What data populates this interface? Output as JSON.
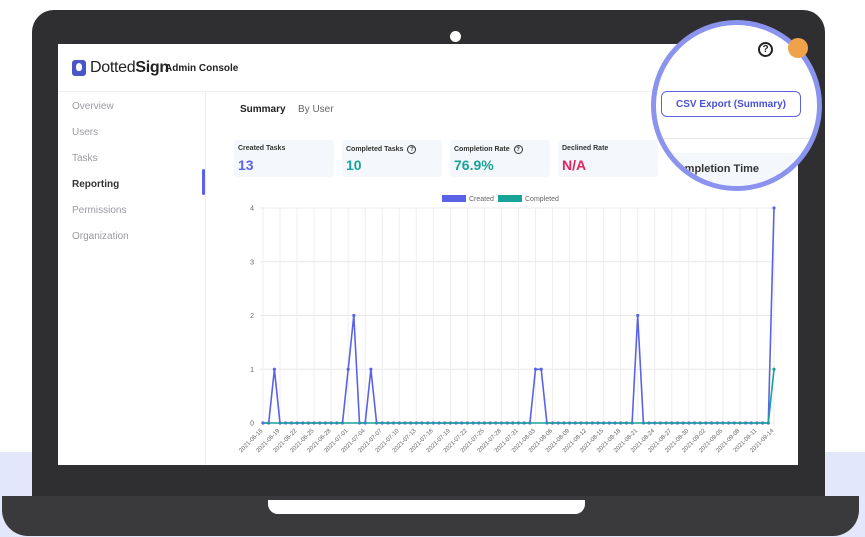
{
  "app": {
    "logo_light": "Dotted",
    "logo_bold": "Sign",
    "console_title": "Admin Console"
  },
  "sidebar": {
    "items": [
      {
        "label": "Overview"
      },
      {
        "label": "Users"
      },
      {
        "label": "Tasks"
      },
      {
        "label": "Reporting",
        "active": true
      },
      {
        "label": "Permissions"
      },
      {
        "label": "Organization"
      }
    ]
  },
  "tabs": [
    {
      "label": "Summary",
      "active": true
    },
    {
      "label": "By User"
    }
  ],
  "cards": [
    {
      "label": "Created Tasks",
      "value": "13",
      "color": "#5a63e6",
      "help": false
    },
    {
      "label": "Completed Tasks",
      "value": "10",
      "color": "#18a398",
      "help": true
    },
    {
      "label": "Completion Rate",
      "value": "76.9%",
      "color": "#18a398",
      "help": true
    },
    {
      "label": "Declined Rate",
      "value": "N/A",
      "color": "#e0245e",
      "help": false
    }
  ],
  "export": {
    "button_label": "CSV Export (Summary)",
    "completion_time_label": "Completion Time"
  },
  "colors": {
    "accent": "#5a63e6",
    "created": "#5a63e6",
    "completed": "#18a398",
    "declined": "#e0245e"
  },
  "icons": {
    "help": "question-circle-icon",
    "avatar": "user-avatar"
  },
  "chart_data": {
    "type": "line",
    "legend": [
      "Created",
      "Completed"
    ],
    "legend_position": "top-center",
    "ylim": [
      0,
      4
    ],
    "yticks": [
      "0",
      "1",
      "2",
      "3",
      "4"
    ],
    "xtick_labels": [
      "2021-06-16",
      "2021-06-19",
      "2021-06-22",
      "2021-06-25",
      "2021-06-28",
      "2021-07-01",
      "2021-07-04",
      "2021-07-07",
      "2021-07-10",
      "2021-07-13",
      "2021-07-16",
      "2021-07-19",
      "2021-07-22",
      "2021-07-25",
      "2021-07-28",
      "2021-07-31",
      "2021-08-03",
      "2021-08-06",
      "2021-08-09",
      "2021-08-12",
      "2021-08-15",
      "2021-08-18",
      "2021-08-21",
      "2021-08-24",
      "2021-08-27",
      "2021-08-30",
      "2021-09-02",
      "2021-09-05",
      "2021-09-08",
      "2021-09-11",
      "2021-09-14"
    ],
    "series": [
      {
        "name": "Created",
        "values": [
          0,
          0,
          1,
          0,
          0,
          0,
          0,
          0,
          0,
          0,
          0,
          0,
          0,
          0,
          0,
          1,
          2,
          0,
          0,
          1,
          0,
          0,
          0,
          0,
          0,
          0,
          0,
          0,
          0,
          0,
          0,
          0,
          0,
          0,
          0,
          0,
          0,
          0,
          0,
          0,
          0,
          0,
          0,
          0,
          0,
          0,
          0,
          0,
          1,
          1,
          0,
          0,
          0,
          0,
          0,
          0,
          0,
          0,
          0,
          0,
          0,
          0,
          0,
          0,
          0,
          0,
          2,
          0,
          0,
          0,
          0,
          0,
          0,
          0,
          0,
          0,
          0,
          0,
          0,
          0,
          0,
          0,
          0,
          0,
          0,
          0,
          0,
          0,
          0,
          0,
          4
        ]
      },
      {
        "name": "Completed",
        "values": [
          0,
          0,
          0,
          0,
          0,
          0,
          0,
          0,
          0,
          0,
          0,
          0,
          0,
          0,
          0,
          0,
          0,
          0,
          0,
          0,
          0,
          0,
          0,
          0,
          0,
          0,
          0,
          0,
          0,
          0,
          0,
          0,
          0,
          0,
          0,
          0,
          0,
          0,
          0,
          0,
          0,
          0,
          0,
          0,
          0,
          0,
          0,
          0,
          0,
          0,
          0,
          0,
          0,
          0,
          0,
          0,
          0,
          0,
          0,
          0,
          0,
          0,
          0,
          0,
          0,
          0,
          0,
          0,
          0,
          0,
          0,
          0,
          0,
          0,
          0,
          0,
          0,
          0,
          0,
          0,
          0,
          0,
          0,
          0,
          0,
          0,
          0,
          0,
          0,
          0,
          1
        ]
      }
    ]
  }
}
